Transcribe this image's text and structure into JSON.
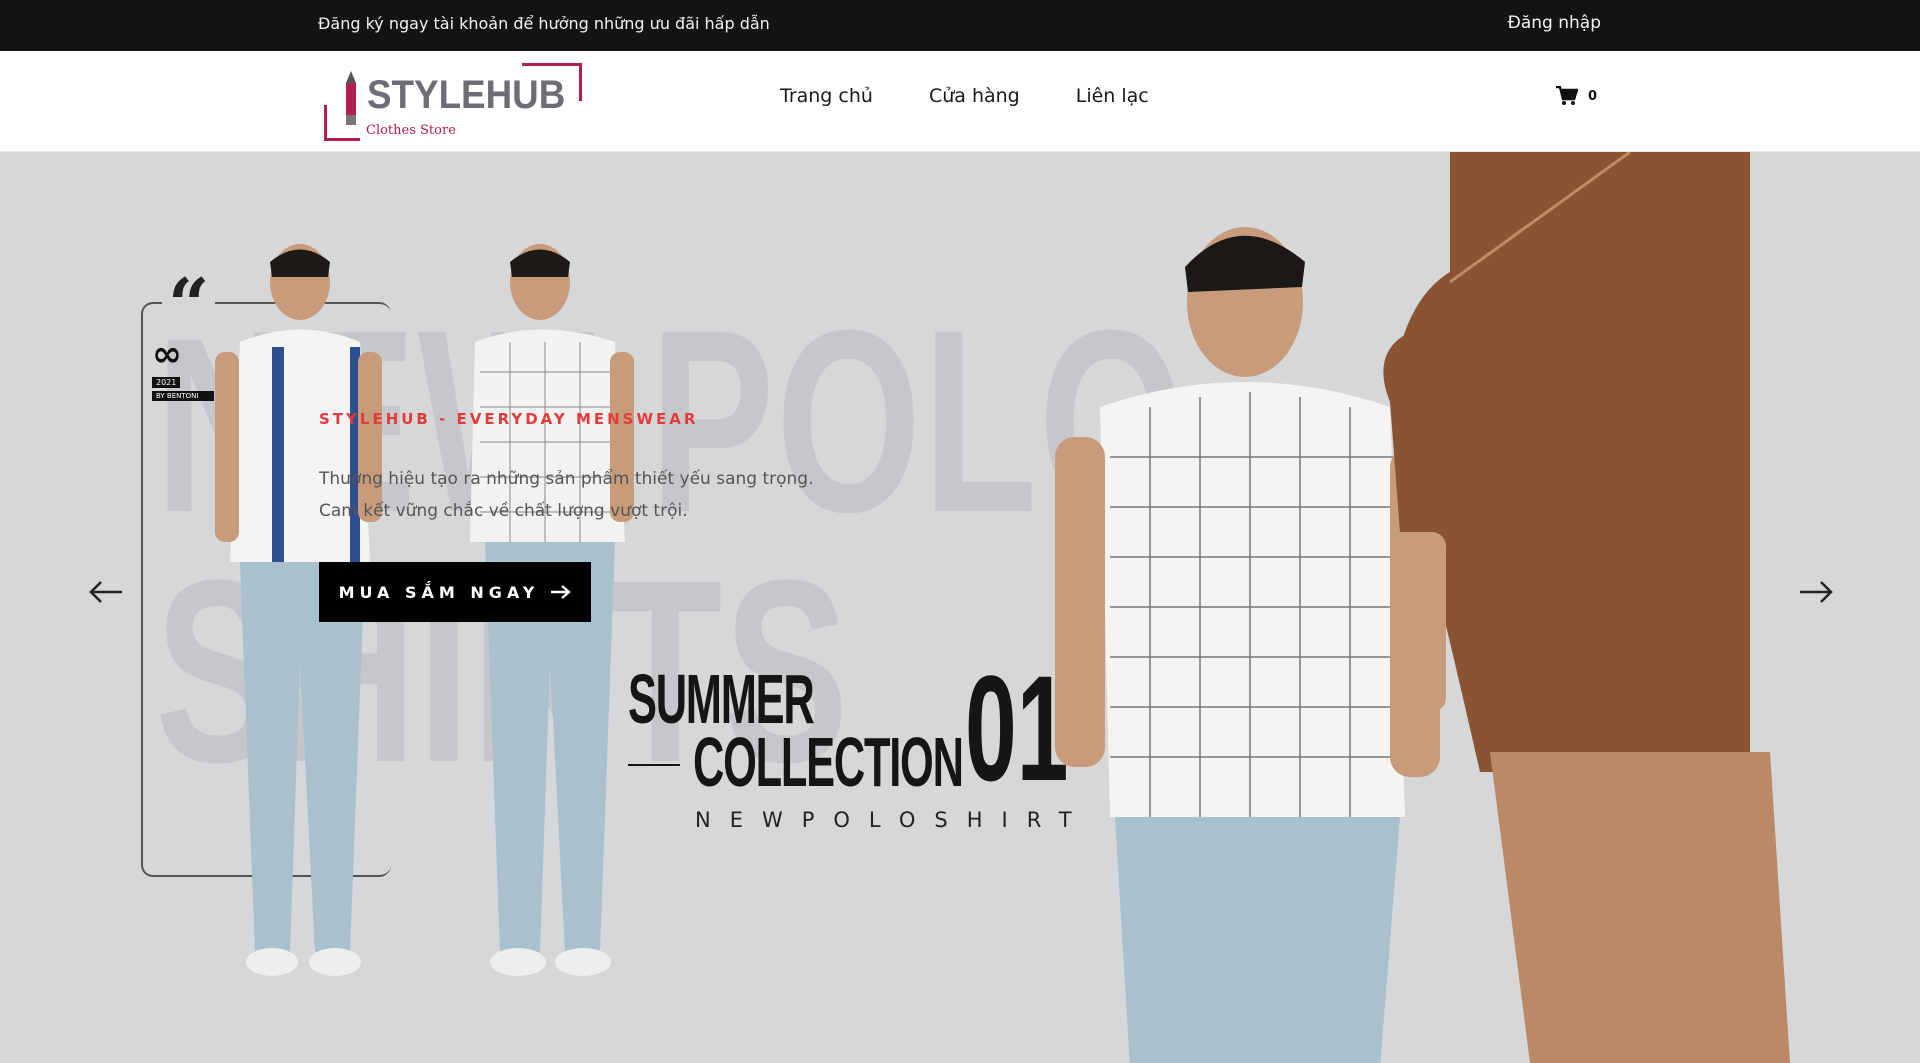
{
  "topbar": {
    "promo": "Đăng ký ngay tài khoản để hưởng những ưu đãi hấp dẫn",
    "login": "Đăng nhập"
  },
  "header": {
    "logo": {
      "brand": "STYLEHUB",
      "tagline": "Clothes Store"
    },
    "nav": [
      {
        "label": "Trang chủ"
      },
      {
        "label": "Cửa hàng"
      },
      {
        "label": "Liên lạc"
      }
    ],
    "cart": {
      "icon": "cart-icon",
      "count": "0"
    }
  },
  "hero": {
    "background_text_line1": "NEW POLO",
    "background_text_line2": "SHIRTS",
    "badge": {
      "year": "2021",
      "by": "BY BENTONI"
    },
    "eyebrow": "STYLEHUB - EVERYDAY MENSWEAR",
    "description": "Thương hiệu tạo ra những sản phẩm thiết yếu sang trọng. Cam kết vững chắc về chất lượng vượt trội.",
    "cta_label": "MUA SẮM NGAY",
    "summer": "SUMMER",
    "collection": "COLLECTION",
    "number": "01",
    "subtitle": "NEWPOLOSHIRT",
    "prev_icon": "arrow-left-icon",
    "next_icon": "arrow-right-icon"
  },
  "colors": {
    "accent": "#b21e4f",
    "eyebrow": "#e23b3b",
    "topbar": "#131313",
    "hero_bg": "#d6d7d9"
  }
}
